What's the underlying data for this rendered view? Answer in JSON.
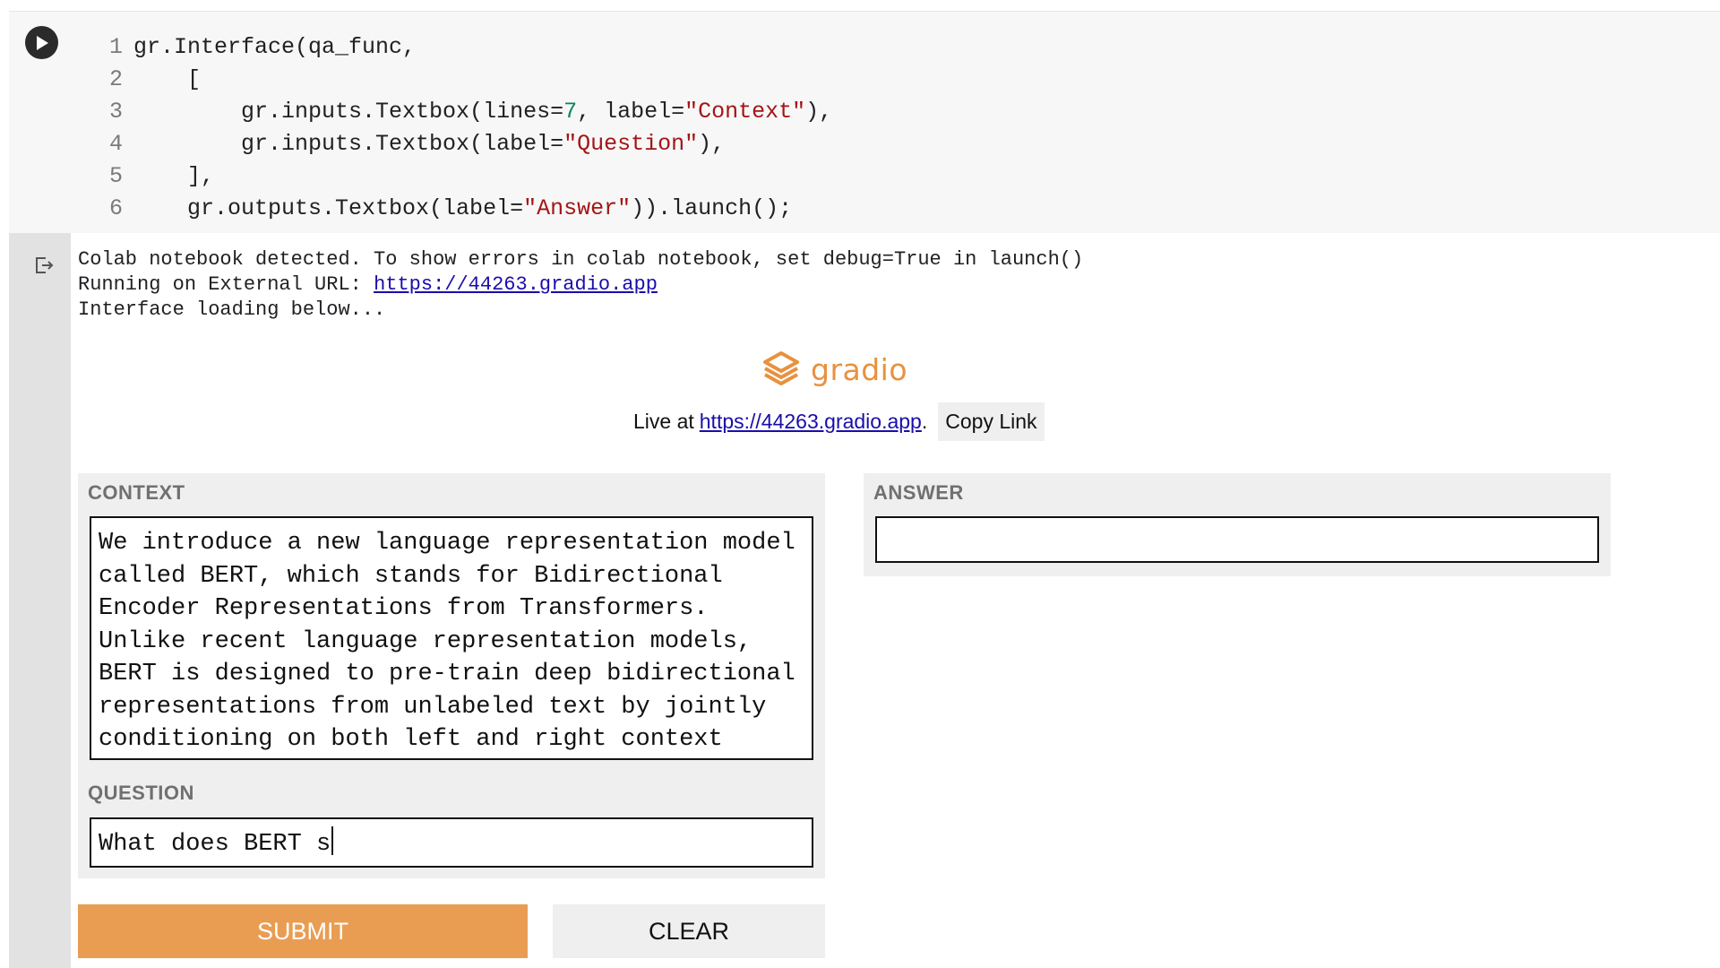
{
  "code_cell": {
    "line_numbers": [
      "1",
      "2",
      "3",
      "4",
      "5",
      "6"
    ],
    "lines": [
      [
        {
          "t": "gr.Interface(qa_func,",
          "c": ""
        }
      ],
      [
        {
          "t": "    [",
          "c": ""
        }
      ],
      [
        {
          "t": "        gr.inputs.Textbox(lines=",
          "c": ""
        },
        {
          "t": "7",
          "c": "num"
        },
        {
          "t": ", label=",
          "c": ""
        },
        {
          "t": "\"Context\"",
          "c": "str"
        },
        {
          "t": "),",
          "c": ""
        }
      ],
      [
        {
          "t": "        gr.inputs.Textbox(label=",
          "c": ""
        },
        {
          "t": "\"Question\"",
          "c": "str"
        },
        {
          "t": "),",
          "c": ""
        }
      ],
      [
        {
          "t": "    ],",
          "c": ""
        }
      ],
      [
        {
          "t": "    gr.outputs.Textbox(label=",
          "c": ""
        },
        {
          "t": "\"Answer\"",
          "c": "str"
        },
        {
          "t": ")).launch();",
          "c": ""
        }
      ]
    ]
  },
  "output": {
    "line1": "Colab notebook detected. To show errors in colab notebook, set debug=True in launch()",
    "line2_prefix": "Running on External URL: ",
    "line2_link": "https://44263.gradio.app",
    "line3": "Interface loading below..."
  },
  "gradio": {
    "brand": "gradio",
    "live_prefix": "Live at",
    "live_link": "https://44263.gradio.app",
    "live_suffix": ".",
    "copy_link_label": "Copy Link",
    "context_label": "CONTEXT",
    "context_value": "We introduce a new language representation model called BERT, which stands for Bidirectional Encoder Representations from Transformers. Unlike recent language representation models, BERT is designed to pre-train deep bidirectional representations from unlabeled text by jointly conditioning on both left and right context",
    "question_label": "QUESTION",
    "question_value": "What does BERT s",
    "answer_label": "ANSWER",
    "answer_value": "",
    "submit_label": "SUBMIT",
    "clear_label": "CLEAR"
  },
  "colors": {
    "accent": "#e99d53",
    "brand": "#e8913f",
    "string": "#a31515",
    "number": "#098658",
    "link": "#1a0dab"
  },
  "icons": {
    "run": "play-circle-icon",
    "output": "output-exit-icon",
    "logo": "gradio-logo-icon"
  }
}
